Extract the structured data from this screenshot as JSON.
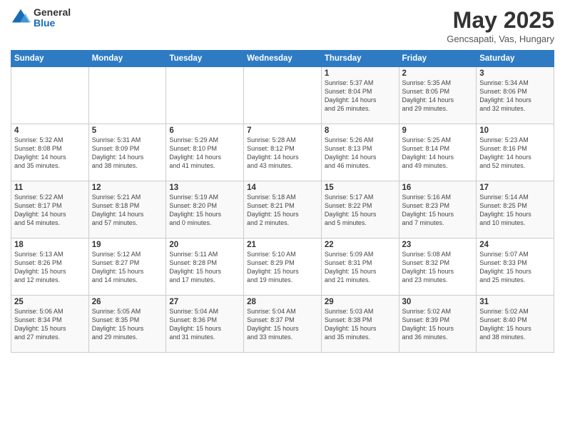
{
  "logo": {
    "general": "General",
    "blue": "Blue"
  },
  "header": {
    "month": "May 2025",
    "location": "Gencsapati, Vas, Hungary"
  },
  "days_of_week": [
    "Sunday",
    "Monday",
    "Tuesday",
    "Wednesday",
    "Thursday",
    "Friday",
    "Saturday"
  ],
  "weeks": [
    [
      {
        "day": "",
        "info": ""
      },
      {
        "day": "",
        "info": ""
      },
      {
        "day": "",
        "info": ""
      },
      {
        "day": "",
        "info": ""
      },
      {
        "day": "1",
        "info": "Sunrise: 5:37 AM\nSunset: 8:04 PM\nDaylight: 14 hours\nand 26 minutes."
      },
      {
        "day": "2",
        "info": "Sunrise: 5:35 AM\nSunset: 8:05 PM\nDaylight: 14 hours\nand 29 minutes."
      },
      {
        "day": "3",
        "info": "Sunrise: 5:34 AM\nSunset: 8:06 PM\nDaylight: 14 hours\nand 32 minutes."
      }
    ],
    [
      {
        "day": "4",
        "info": "Sunrise: 5:32 AM\nSunset: 8:08 PM\nDaylight: 14 hours\nand 35 minutes."
      },
      {
        "day": "5",
        "info": "Sunrise: 5:31 AM\nSunset: 8:09 PM\nDaylight: 14 hours\nand 38 minutes."
      },
      {
        "day": "6",
        "info": "Sunrise: 5:29 AM\nSunset: 8:10 PM\nDaylight: 14 hours\nand 41 minutes."
      },
      {
        "day": "7",
        "info": "Sunrise: 5:28 AM\nSunset: 8:12 PM\nDaylight: 14 hours\nand 43 minutes."
      },
      {
        "day": "8",
        "info": "Sunrise: 5:26 AM\nSunset: 8:13 PM\nDaylight: 14 hours\nand 46 minutes."
      },
      {
        "day": "9",
        "info": "Sunrise: 5:25 AM\nSunset: 8:14 PM\nDaylight: 14 hours\nand 49 minutes."
      },
      {
        "day": "10",
        "info": "Sunrise: 5:23 AM\nSunset: 8:16 PM\nDaylight: 14 hours\nand 52 minutes."
      }
    ],
    [
      {
        "day": "11",
        "info": "Sunrise: 5:22 AM\nSunset: 8:17 PM\nDaylight: 14 hours\nand 54 minutes."
      },
      {
        "day": "12",
        "info": "Sunrise: 5:21 AM\nSunset: 8:18 PM\nDaylight: 14 hours\nand 57 minutes."
      },
      {
        "day": "13",
        "info": "Sunrise: 5:19 AM\nSunset: 8:20 PM\nDaylight: 15 hours\nand 0 minutes."
      },
      {
        "day": "14",
        "info": "Sunrise: 5:18 AM\nSunset: 8:21 PM\nDaylight: 15 hours\nand 2 minutes."
      },
      {
        "day": "15",
        "info": "Sunrise: 5:17 AM\nSunset: 8:22 PM\nDaylight: 15 hours\nand 5 minutes."
      },
      {
        "day": "16",
        "info": "Sunrise: 5:16 AM\nSunset: 8:23 PM\nDaylight: 15 hours\nand 7 minutes."
      },
      {
        "day": "17",
        "info": "Sunrise: 5:14 AM\nSunset: 8:25 PM\nDaylight: 15 hours\nand 10 minutes."
      }
    ],
    [
      {
        "day": "18",
        "info": "Sunrise: 5:13 AM\nSunset: 8:26 PM\nDaylight: 15 hours\nand 12 minutes."
      },
      {
        "day": "19",
        "info": "Sunrise: 5:12 AM\nSunset: 8:27 PM\nDaylight: 15 hours\nand 14 minutes."
      },
      {
        "day": "20",
        "info": "Sunrise: 5:11 AM\nSunset: 8:28 PM\nDaylight: 15 hours\nand 17 minutes."
      },
      {
        "day": "21",
        "info": "Sunrise: 5:10 AM\nSunset: 8:29 PM\nDaylight: 15 hours\nand 19 minutes."
      },
      {
        "day": "22",
        "info": "Sunrise: 5:09 AM\nSunset: 8:31 PM\nDaylight: 15 hours\nand 21 minutes."
      },
      {
        "day": "23",
        "info": "Sunrise: 5:08 AM\nSunset: 8:32 PM\nDaylight: 15 hours\nand 23 minutes."
      },
      {
        "day": "24",
        "info": "Sunrise: 5:07 AM\nSunset: 8:33 PM\nDaylight: 15 hours\nand 25 minutes."
      }
    ],
    [
      {
        "day": "25",
        "info": "Sunrise: 5:06 AM\nSunset: 8:34 PM\nDaylight: 15 hours\nand 27 minutes."
      },
      {
        "day": "26",
        "info": "Sunrise: 5:05 AM\nSunset: 8:35 PM\nDaylight: 15 hours\nand 29 minutes."
      },
      {
        "day": "27",
        "info": "Sunrise: 5:04 AM\nSunset: 8:36 PM\nDaylight: 15 hours\nand 31 minutes."
      },
      {
        "day": "28",
        "info": "Sunrise: 5:04 AM\nSunset: 8:37 PM\nDaylight: 15 hours\nand 33 minutes."
      },
      {
        "day": "29",
        "info": "Sunrise: 5:03 AM\nSunset: 8:38 PM\nDaylight: 15 hours\nand 35 minutes."
      },
      {
        "day": "30",
        "info": "Sunrise: 5:02 AM\nSunset: 8:39 PM\nDaylight: 15 hours\nand 36 minutes."
      },
      {
        "day": "31",
        "info": "Sunrise: 5:02 AM\nSunset: 8:40 PM\nDaylight: 15 hours\nand 38 minutes."
      }
    ]
  ]
}
